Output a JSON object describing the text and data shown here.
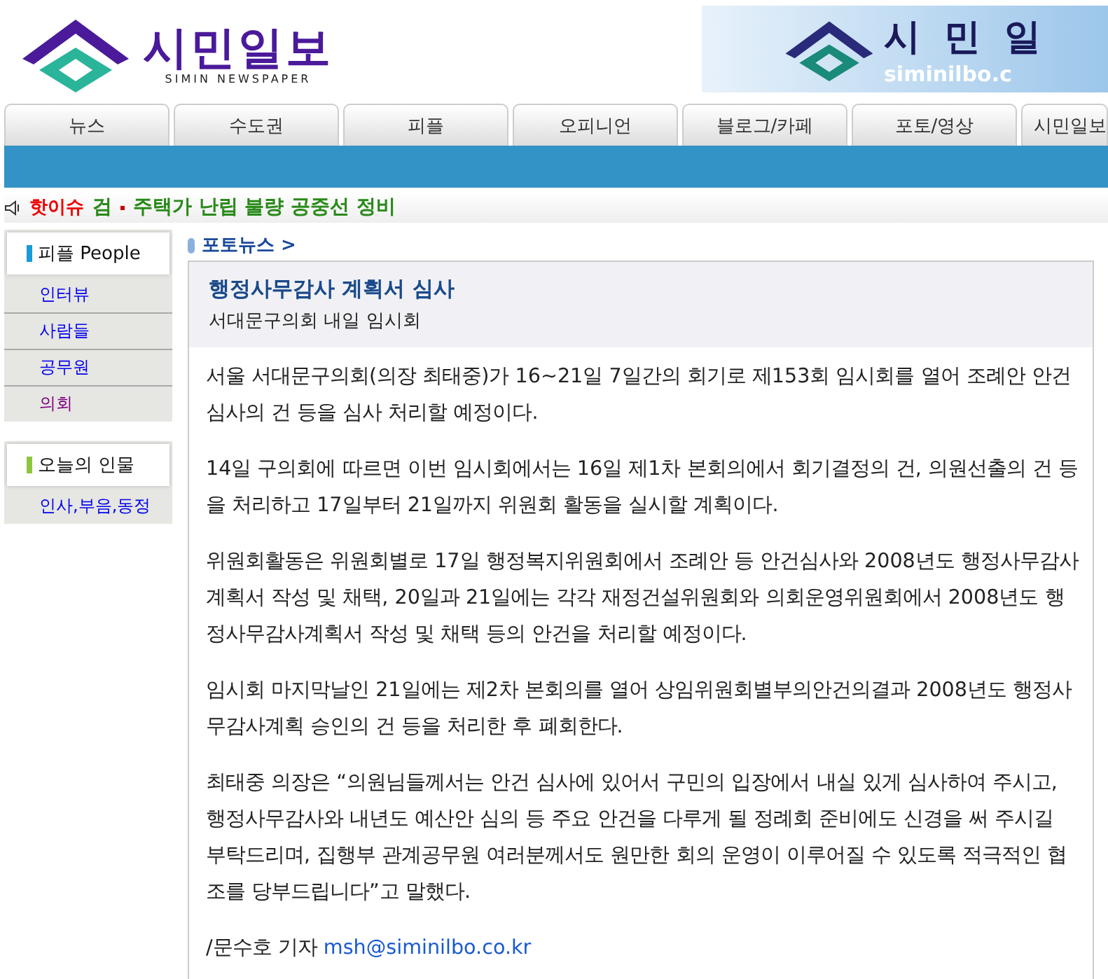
{
  "logo": {
    "title": "시민일보",
    "subtitle": "SIMIN NEWSPAPER"
  },
  "banner": {
    "title": "시 민 일",
    "url": "siminilbo.c"
  },
  "nav": [
    {
      "label": "뉴스"
    },
    {
      "label": "수도권"
    },
    {
      "label": "피플"
    },
    {
      "label": "오피니언"
    },
    {
      "label": "블로그/카페"
    },
    {
      "label": "포토/영상"
    },
    {
      "label": "시민일보"
    }
  ],
  "ticker": {
    "label": "핫이슈",
    "items": [
      "검",
      "주택가 난립 불량 공중선 정비"
    ]
  },
  "sidebar": [
    {
      "title": "피플 People",
      "color": "#1a9ad6",
      "items": [
        {
          "label": "인터뷰",
          "visited": false
        },
        {
          "label": "사람들",
          "visited": false
        },
        {
          "label": "공무원",
          "visited": false
        },
        {
          "label": "의회",
          "visited": true
        }
      ]
    },
    {
      "title": "오늘의 인물",
      "color": "#8cc63f",
      "items": [
        {
          "label": "인사,부음,동정",
          "visited": false
        }
      ]
    }
  ],
  "breadcrumb": "포토뉴스 >",
  "article": {
    "title": "행정사무감사 계획서 심사",
    "subtitle": "서대문구의회 내일 임시회",
    "paragraphs": [
      "서울 서대문구의회(의장 최태중)가 16~21일 7일간의 회기로 제153회 임시회를 열어 조례안 안건심사의 건 등을 심사 처리할 예정이다.",
      "14일 구의회에 따르면 이번 임시회에서는 16일 제1차 본회의에서 회기결정의 건, 의원선출의 건 등을 처리하고 17일부터 21일까지 위원회 활동을 실시할 계획이다.",
      "위원회활동은 위원회별로 17일 행정복지위원회에서 조례안 등 안건심사와 2008년도 행정사무감사계획서 작성 및 채택, 20일과 21일에는 각각 재정건설위원회와 의회운영위원회에서 2008년도 행정사무감사계획서 작성 및 채택 등의 안건을 처리할 예정이다.",
      "임시회 마지막날인 21일에는 제2차 본회의를 열어 상임위원회별부의안건의결과 2008년도 행정사무감사계획 승인의 건 등을 처리한 후 폐회한다.",
      "최태중 의장은 “의원님들께서는 안건 심사에 있어서 구민의 입장에서 내실 있게 심사하여 주시고, 행정사무감사와 내년도 예산안 심의 등 주요 안건을 다루게 될 정례회 준비에도 신경을 써 주시길 부탁드리며, 집행부 관계공무원 여러분께서도 원만한 회의 운영이 이루어질 수 있도록 적극적인 협조를 당부드립니다”고 말했다."
    ],
    "byline": "/문수호 기자",
    "email": "msh@siminilbo.co.kr"
  }
}
